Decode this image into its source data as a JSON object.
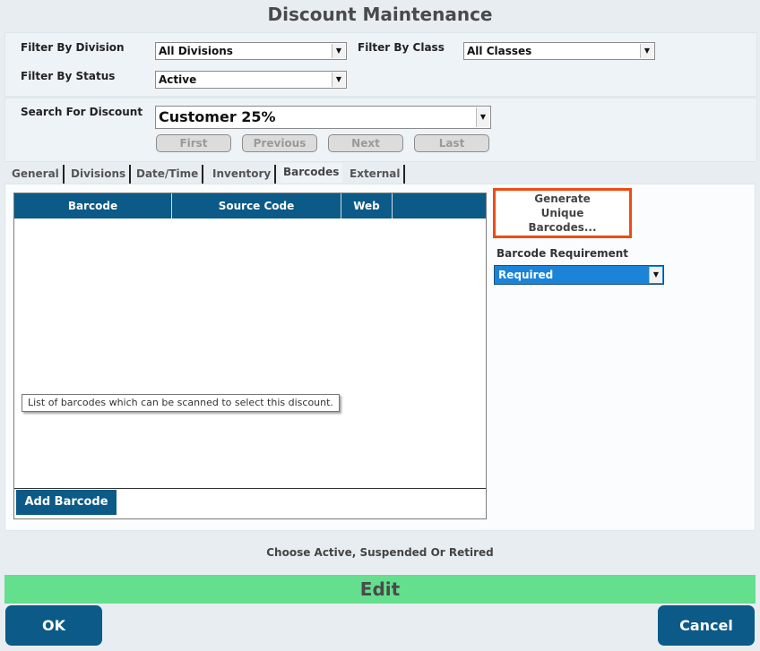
{
  "window": {
    "title": "Discount Maintenance"
  },
  "filters": {
    "division_label": "Filter By Division",
    "division_value": "All Divisions",
    "class_label": "Filter By Class",
    "class_value": "All Classes",
    "status_label": "Filter By Status",
    "status_value": "Active"
  },
  "search": {
    "label": "Search For Discount",
    "value": "Customer 25%"
  },
  "nav_buttons": {
    "first": "First",
    "previous": "Previous",
    "next": "Next",
    "last": "Last"
  },
  "tabs": [
    {
      "label": "General"
    },
    {
      "label": "Divisions"
    },
    {
      "label": "Date/Time"
    },
    {
      "label": "Inventory"
    },
    {
      "label": "Barcodes",
      "active": true
    },
    {
      "label": "External"
    }
  ],
  "barcode_grid": {
    "columns": [
      "Barcode",
      "Source Code",
      "Web",
      ""
    ],
    "rows": [],
    "tooltip": "List of barcodes which can be scanned to select this discount.",
    "add_button": "Add Barcode"
  },
  "side": {
    "generate_button": "Generate Unique Barcodes...",
    "requirement_label": "Barcode Requirement",
    "requirement_value": "Required"
  },
  "status_hint": "Choose Active, Suspended Or Retired",
  "mode_bar": "Edit",
  "footer": {
    "ok": "OK",
    "cancel": "Cancel"
  },
  "colors": {
    "header_blue": "#0c5a87",
    "edit_green": "#63df8d",
    "highlight_orange": "#ef4b12",
    "selected_blue": "#1b84d8"
  }
}
